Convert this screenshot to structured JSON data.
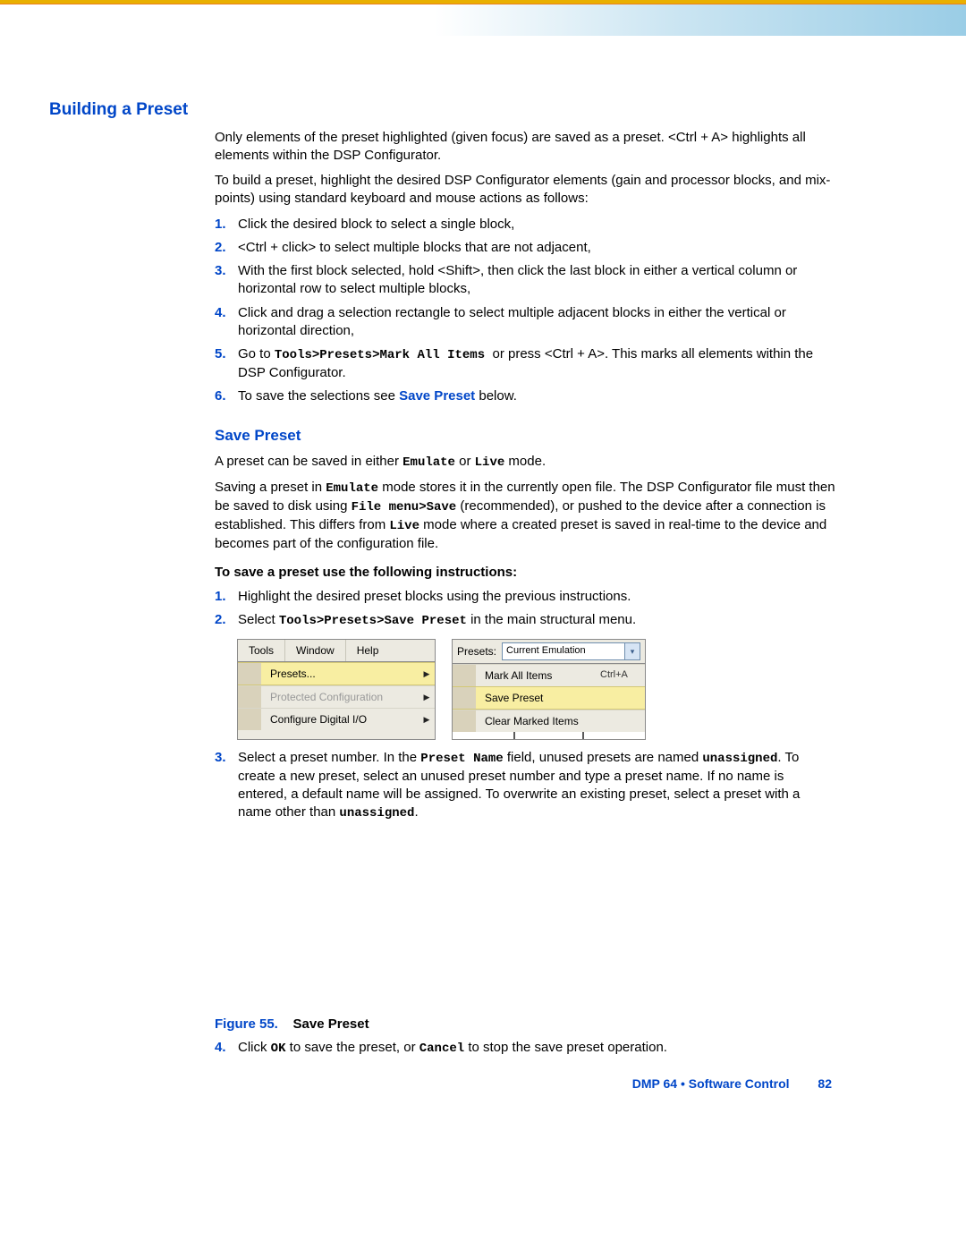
{
  "h1": "Building a Preset",
  "p1": "Only elements of the preset highlighted (given focus) are saved as a preset. <Ctrl + A> highlights all elements within the DSP Configurator.",
  "p2": "To build a preset, highlight the desired DSP Configurator elements (gain and processor blocks, and mix-points) using standard keyboard and mouse actions as follows:",
  "steps1": {
    "n1": "1.",
    "t1": "Click the desired block to select a single block,",
    "n2": "2.",
    "t2": "<Ctrl + click> to select multiple blocks that are not adjacent,",
    "n3": "3.",
    "t3": "With the first block selected, hold <Shift>, then click the last block in either a vertical column or horizontal row to select multiple blocks,",
    "n4": "4.",
    "t4": "Click and drag a selection rectangle to select multiple adjacent blocks in either the vertical or horizontal direction,",
    "n5": "5.",
    "t5a": "Go to ",
    "t5mono": "Tools>Presets>Mark All Items ",
    "t5b": " or press <Ctrl + A>. This marks all elements within the DSP Configurator.",
    "n6": "6.",
    "t6a": "To save the selections see ",
    "t6link": "Save Preset",
    "t6b": " below."
  },
  "h2": "Save Preset",
  "sp_p1a": "A preset can be saved in either ",
  "sp_p1m1": "Emulate",
  "sp_p1b": " or ",
  "sp_p1m2": "Live",
  "sp_p1c": " mode.",
  "sp_p2a": "Saving a preset in ",
  "sp_p2m1": "Emulate",
  "sp_p2b": " mode stores it in the currently open file. The DSP Configurator file must then be saved to disk using ",
  "sp_p2m2": "File menu>Save",
  "sp_p2c": " (recommended), or pushed to the device after a connection is established. This differs from ",
  "sp_p2m3": "Live",
  "sp_p2d": " mode where a created preset is saved in real-time to the device and becomes part of the configuration file.",
  "instr_head": "To save a preset use the following instructions:",
  "steps2": {
    "n1": "1.",
    "t1": "Highlight the desired preset blocks using the previous instructions.",
    "n2": "2.",
    "t2a": "Select ",
    "t2m": "Tools>Presets>Save Preset",
    "t2b": " in the main structural menu.",
    "n3": "3.",
    "t3a": "Select a preset number. In the ",
    "t3m1": "Preset Name",
    "t3b": " field, unused presets are named ",
    "t3m2": "unassigned",
    "t3c": ". To create a new preset, select an unused preset number and type a preset name. If no name is entered, a default name will be assigned. To overwrite an existing preset, select a preset with a name other than ",
    "t3m3": "unassigned",
    "t3d": ".",
    "n4": "4.",
    "t4a": "Click ",
    "t4m1": "OK",
    "t4b": " to save the preset, or ",
    "t4m2": "Cancel",
    "t4c": " to stop the save preset operation."
  },
  "menu": {
    "left_top": {
      "tools": "Tools",
      "window": "Window",
      "help": "Help"
    },
    "left_rows": {
      "presets": "Presets...",
      "protected": "Protected Configuration",
      "digital": "Configure Digital I/O"
    },
    "right_top": {
      "plabel": "Presets:",
      "combo": "Current Emulation"
    },
    "right_rows": {
      "mark": "Mark All Items",
      "mark_sc": "Ctrl+A",
      "save": "Save Preset",
      "clear": "Clear Marked Items"
    }
  },
  "fig": {
    "label": "Figure 55.",
    "title": "Save Preset"
  },
  "footer": {
    "text": "DMP 64 • Software Control",
    "page": "82"
  }
}
